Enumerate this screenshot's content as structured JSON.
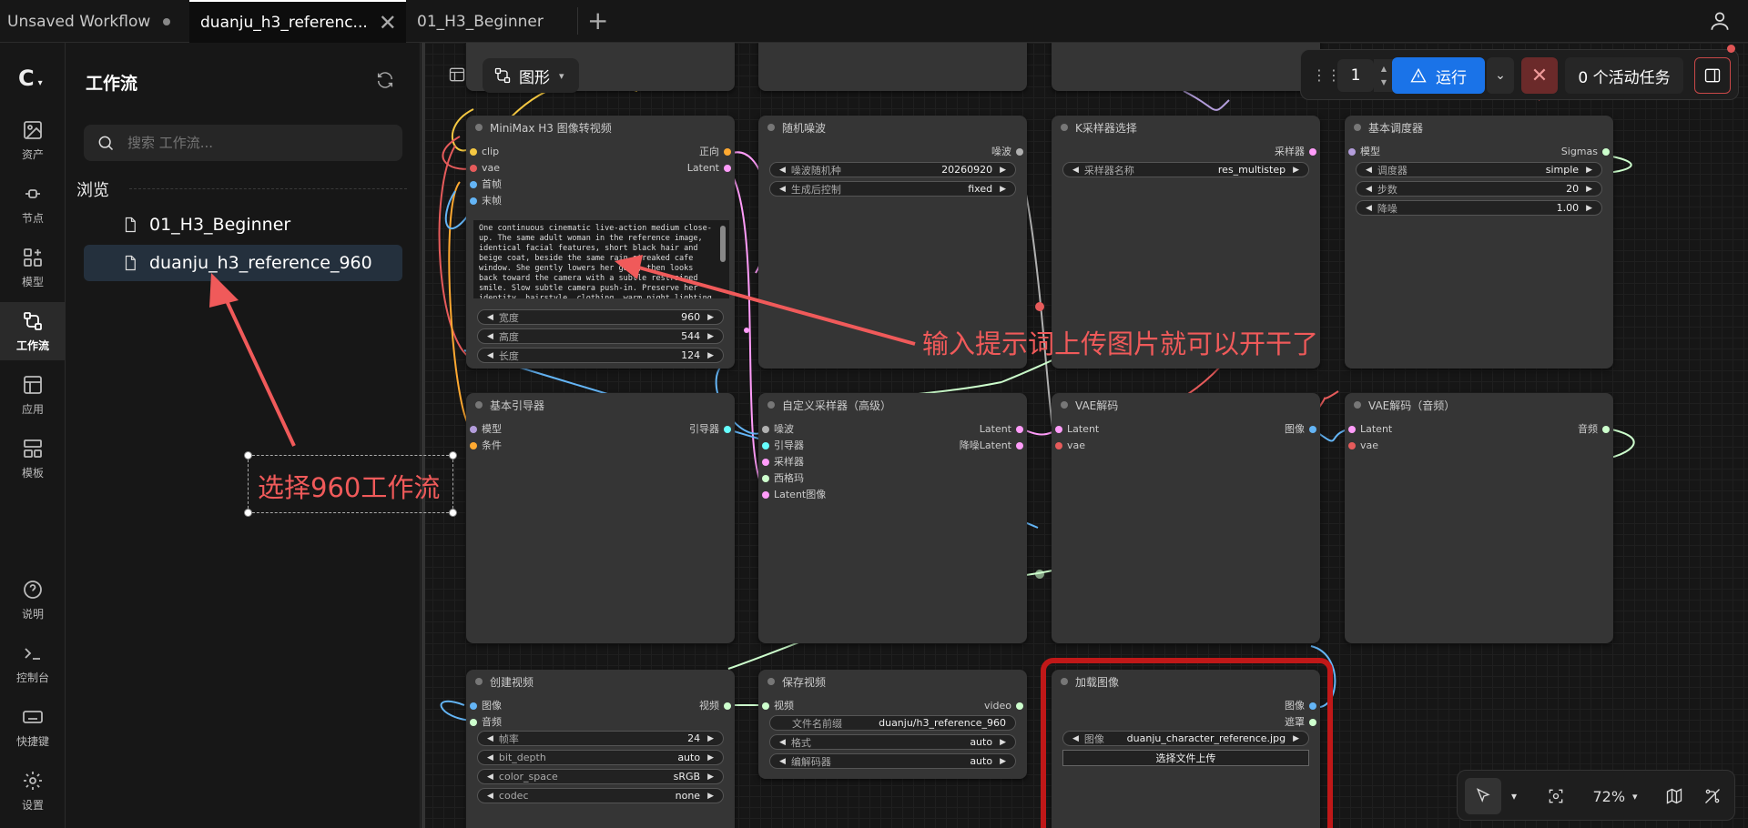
{
  "tabs": [
    {
      "label": "Unsaved Workflow",
      "modified": true
    },
    {
      "label": "duanju_h3_referenc...",
      "active": true
    },
    {
      "label": "01_H3_Beginner"
    }
  ],
  "rail": {
    "items": [
      {
        "label": "资产",
        "icon": "image-icon"
      },
      {
        "label": "节点",
        "icon": "node-icon"
      },
      {
        "label": "模型",
        "icon": "model-icon"
      },
      {
        "label": "工作流",
        "icon": "workflow-icon",
        "active": true
      },
      {
        "label": "应用",
        "icon": "app-icon"
      },
      {
        "label": "模板",
        "icon": "template-icon"
      }
    ],
    "bottom": [
      {
        "label": "说明",
        "icon": "help-icon"
      },
      {
        "label": "控制台",
        "icon": "terminal-icon"
      },
      {
        "label": "快捷键",
        "icon": "keyboard-icon"
      },
      {
        "label": "设置",
        "icon": "settings-icon"
      }
    ]
  },
  "panel": {
    "title": "工作流",
    "search_placeholder": "搜索 工作流...",
    "browse_label": "浏览",
    "workflows": [
      "01_H3_Beginner",
      "duanju_h3_reference_960"
    ]
  },
  "canvas_toolbar": {
    "graph_label": "图形"
  },
  "run_bar": {
    "count": "1",
    "run_label": "运行",
    "tasks_label": "0 个活动任务"
  },
  "bottom_bar": {
    "zoom": "72%"
  },
  "annotations": {
    "prompt_note": "输入提示词上传图片就可以开干了",
    "select_note": "选择960工作流"
  },
  "nodes": {
    "minimax": {
      "title": "MiniMax H3 图像转视频",
      "inputs": [
        "clip",
        "vae",
        "首帧",
        "末帧"
      ],
      "outputs": [
        "正向",
        "Latent"
      ],
      "prompt_text": "One continuous cinematic live-action medium close-up. The same adult woman in the reference image, identical facial features, short black hair and beige coat, beside the same rain-streaked cafe window. She gently lowers her gaze, then looks back toward the camera with a subtle restrained smile. Slow subtle camera push-in. Preserve her identity, hairstyle, clothing, warm night lighting and window reflections. Natural movement, photorealistic.",
      "widgets": [
        {
          "label": "宽度",
          "value": "960"
        },
        {
          "label": "高度",
          "value": "544"
        },
        {
          "label": "长度",
          "value": "124"
        }
      ]
    },
    "noise": {
      "title": "随机噪波",
      "outputs": [
        "噪波"
      ],
      "widgets": [
        {
          "label": "噪波随机种",
          "value": "20260920"
        },
        {
          "label": "生成后控制",
          "value": "fixed"
        }
      ]
    },
    "ksampler_select": {
      "title": "K采样器选择",
      "outputs": [
        "采样器"
      ],
      "widgets": [
        {
          "label": "采样器名称",
          "value": "res_multistep"
        }
      ]
    },
    "scheduler": {
      "title": "基本调度器",
      "inputs": [
        "模型"
      ],
      "outputs": [
        "Sigmas"
      ],
      "widgets": [
        {
          "label": "调度器",
          "value": "simple"
        },
        {
          "label": "步数",
          "value": "20"
        },
        {
          "label": "降噪",
          "value": "1.00"
        }
      ]
    },
    "guider": {
      "title": "基本引导器",
      "inputs": [
        "模型",
        "条件"
      ],
      "outputs": [
        "引导器"
      ]
    },
    "custom_sampler": {
      "title": "自定义采样器（高级）",
      "inputs": [
        "噪波",
        "引导器",
        "采样器",
        "西格玛",
        "Latent图像"
      ],
      "outputs": [
        "Latent",
        "降噪Latent"
      ]
    },
    "vae_decode": {
      "title": "VAE解码",
      "inputs": [
        "Latent",
        "vae"
      ],
      "outputs": [
        "图像"
      ]
    },
    "vae_decode_audio": {
      "title": "VAE解码（音频）",
      "inputs": [
        "Latent",
        "vae"
      ],
      "outputs": [
        "音频"
      ]
    },
    "create_video": {
      "title": "创建视频",
      "inputs": [
        "图像",
        "音频"
      ],
      "outputs": [
        "视频"
      ],
      "widgets": [
        {
          "label": "帧率",
          "value": "24"
        },
        {
          "label": "bit_depth",
          "value": "auto"
        },
        {
          "label": "color_space",
          "value": "sRGB"
        },
        {
          "label": "codec",
          "value": "none"
        }
      ]
    },
    "save_video": {
      "title": "保存视频",
      "inputs": [
        "视频"
      ],
      "outputs": [
        "video"
      ],
      "widgets": [
        {
          "label": "文件名前缀",
          "value": "duanju/h3_reference_960"
        },
        {
          "label": "格式",
          "value": "auto"
        },
        {
          "label": "编解码器",
          "value": "auto"
        }
      ]
    },
    "load_image": {
      "title": "加载图像",
      "outputs": [
        "图像",
        "遮罩"
      ],
      "widgets": [
        {
          "label": "图像",
          "value": "duanju_character_reference.jpg"
        }
      ],
      "upload_label": "选择文件上传"
    }
  },
  "colors": {
    "accent": "#1a73e8",
    "annotation": "#f05a5a",
    "clip": "#f5c842",
    "vae": "#e65b5b",
    "image": "#64b5f6",
    "latent": "#ff9cf9",
    "model": "#b39ddb",
    "conditioning": "#ffa931",
    "noise": "#b0b0b0",
    "sigmas": "#cdffcd"
  }
}
